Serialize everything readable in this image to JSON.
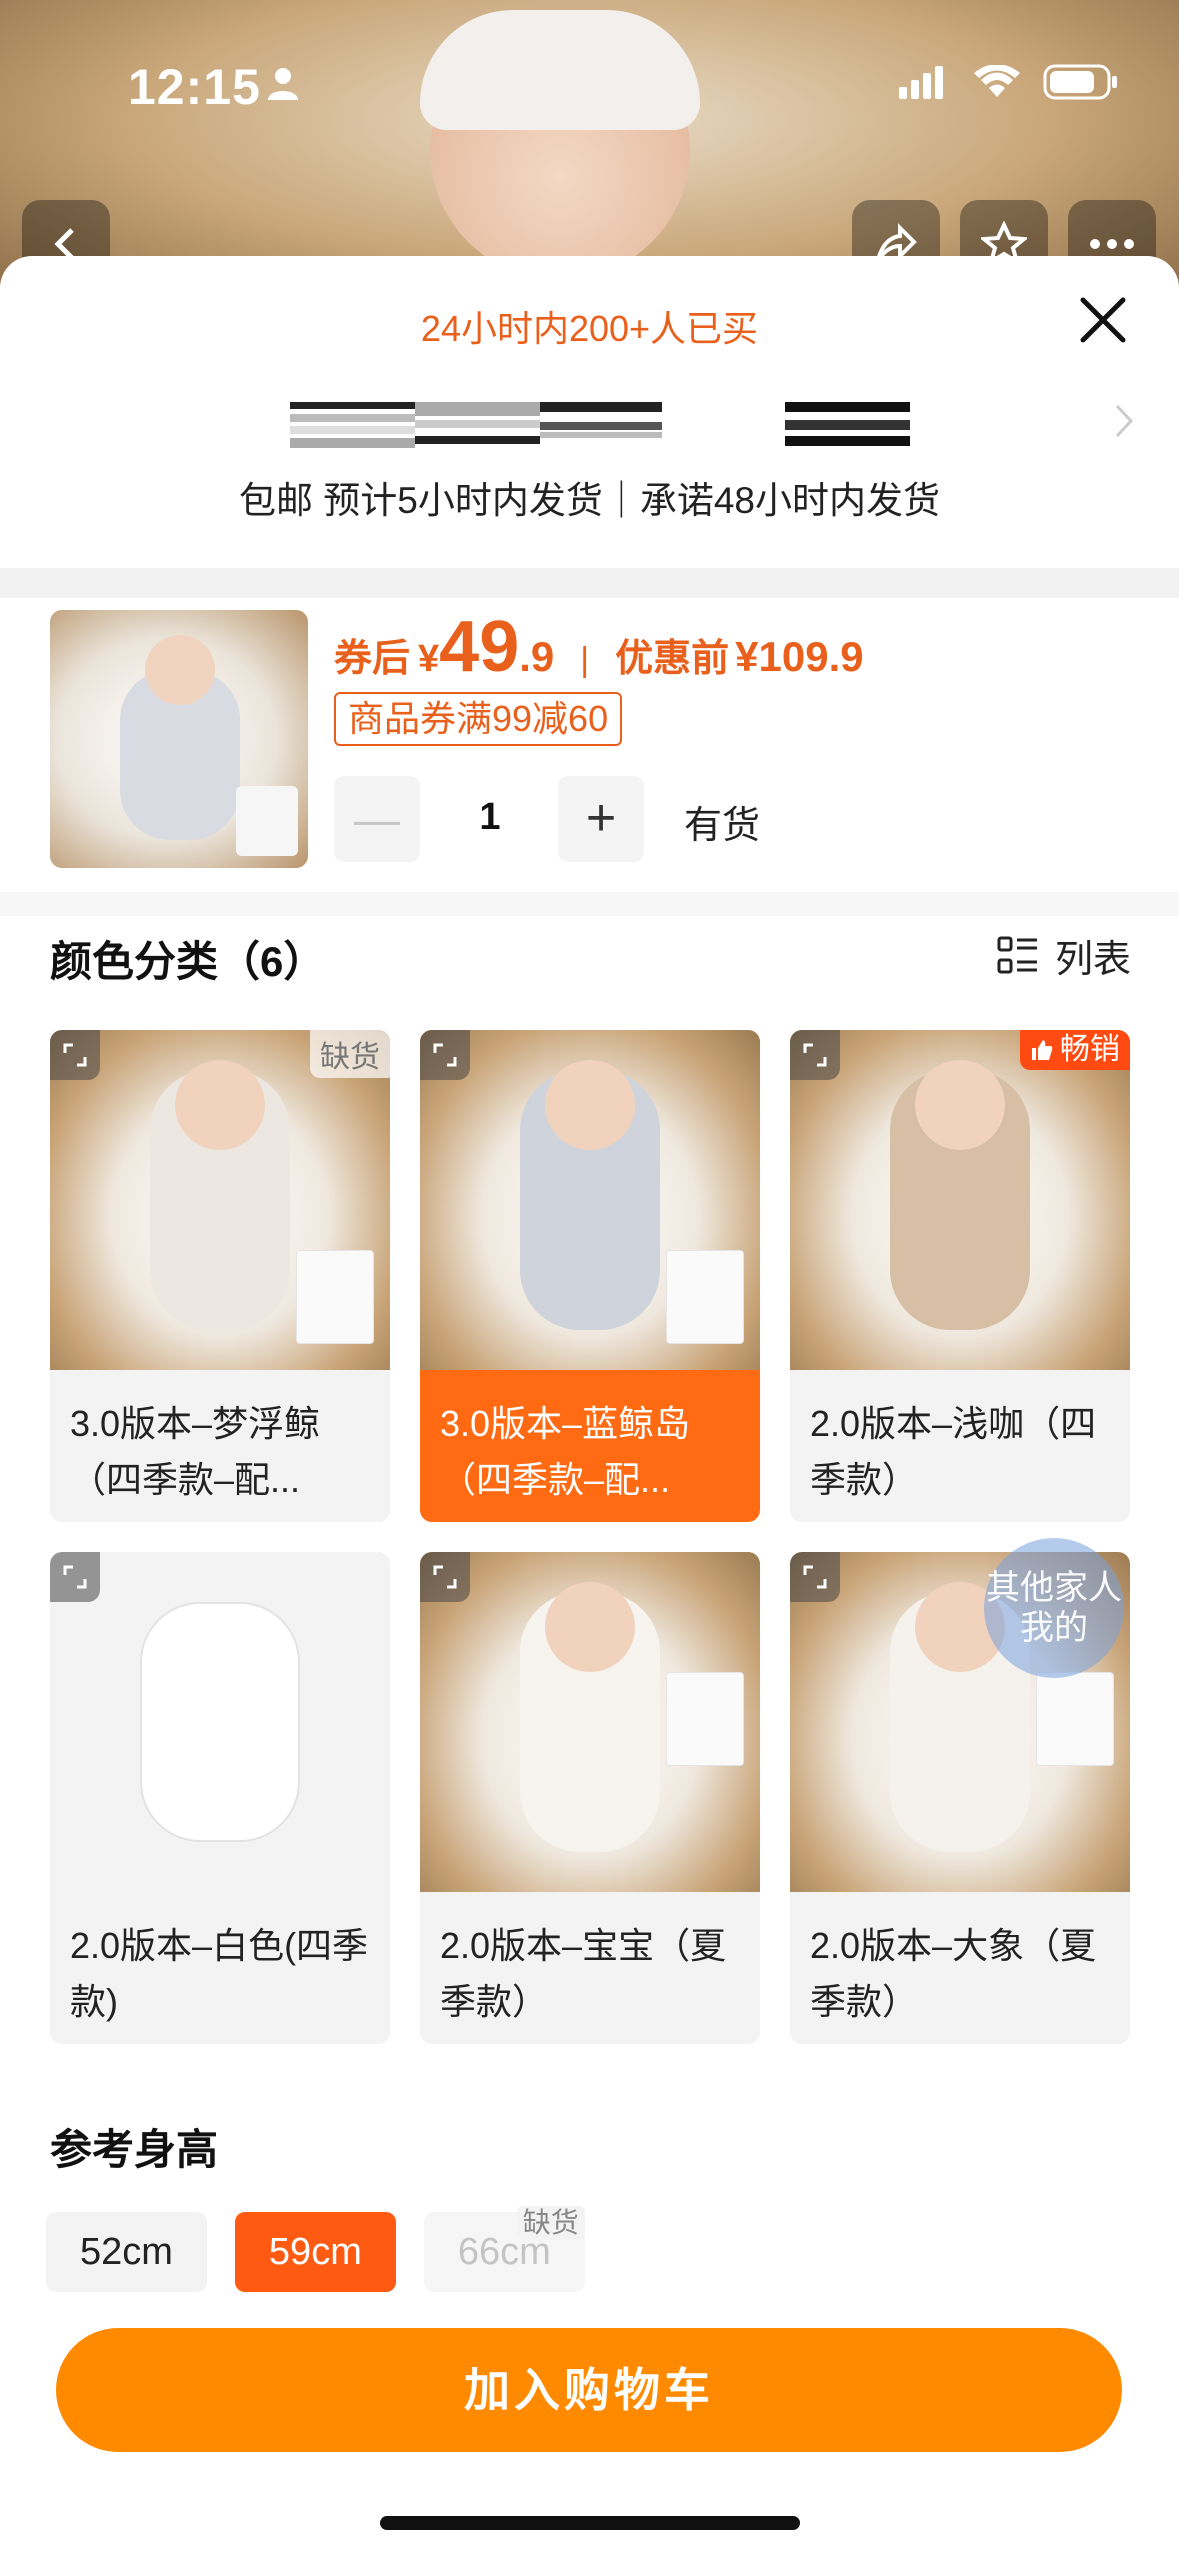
{
  "status_bar": {
    "time": "12:15"
  },
  "header": {
    "sold_count": "24小时内200+人已买",
    "shipping": "包邮  预计5小时内发货｜承诺48小时内发货"
  },
  "selected_sku": {
    "price_label": "券后",
    "currency": "¥",
    "price_int": "49",
    "price_dec": ".9",
    "separator": "|",
    "orig_label": "优惠前",
    "orig_price": "¥109.9",
    "coupon": "商品券满99减60",
    "qty_minus": "—",
    "quantity": "1",
    "qty_plus": "+",
    "stock": "有货"
  },
  "colors": {
    "title": "颜色分类（6）",
    "list_toggle": "列表",
    "items": [
      {
        "caption": "3.0版本–梦浮鲸（四季款–配...",
        "badge": "缺货",
        "selected": false
      },
      {
        "caption": "3.0版本–蓝鲸岛（四季款–配...",
        "badge": "",
        "selected": true
      },
      {
        "caption": "2.0版本–浅咖（四季款）",
        "badge": "畅销",
        "selected": false
      },
      {
        "caption": "2.0版本–白色(四季款)",
        "badge": "",
        "selected": false
      },
      {
        "caption": "2.0版本–宝宝（夏季款）",
        "badge": "",
        "selected": false
      },
      {
        "caption": "2.0版本–大象（夏季款）",
        "badge": "",
        "selected": false
      }
    ]
  },
  "family_bubble": "其他家人我的",
  "sizes": {
    "title": "参考身高",
    "items": [
      {
        "label": "52cm",
        "state": "normal",
        "badge": ""
      },
      {
        "label": "59cm",
        "state": "selected",
        "badge": ""
      },
      {
        "label": "66cm",
        "state": "disabled",
        "badge": "缺货"
      }
    ]
  },
  "cart_button": "加入购物车",
  "theme": {
    "accent": "#ff6a13",
    "price": "#e8601c",
    "cart": "#ff8a00"
  }
}
